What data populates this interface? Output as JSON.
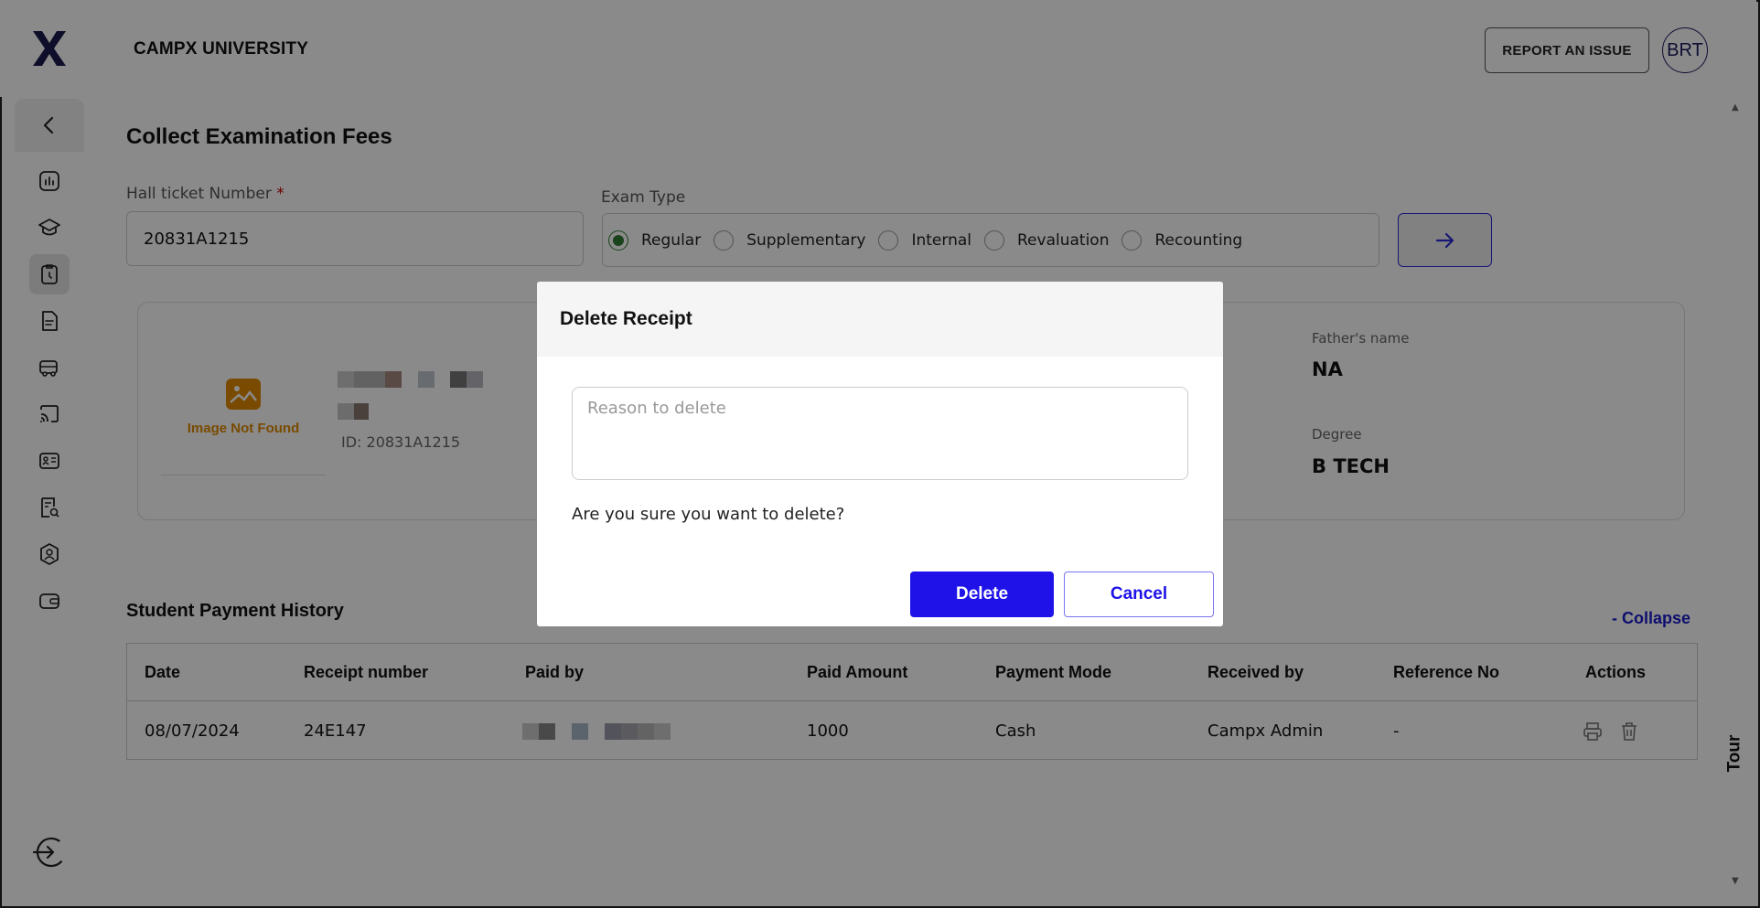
{
  "header": {
    "brand": "CAMPX UNIVERSITY",
    "report_label": "REPORT AN ISSUE",
    "avatar_initials": "BRT"
  },
  "sidebar": {
    "items": [
      {
        "icon": "analytics-icon"
      },
      {
        "icon": "graduation-cap-icon"
      },
      {
        "icon": "exam-clipboard-icon",
        "active": true
      },
      {
        "icon": "document-icon"
      },
      {
        "icon": "bus-icon"
      },
      {
        "icon": "cast-icon"
      },
      {
        "icon": "id-card-icon"
      },
      {
        "icon": "receipt-search-icon"
      },
      {
        "icon": "user-badge-icon"
      },
      {
        "icon": "wallet-icon"
      }
    ]
  },
  "page": {
    "title": "Collect Examination Fees",
    "hall_ticket_label": "Hall ticket Number",
    "hall_ticket_required": "*",
    "hall_ticket_value": "20831A1215",
    "exam_type_label": "Exam Type",
    "exam_types": [
      "Regular",
      "Supplementary",
      "Internal",
      "Revaluation",
      "Recounting"
    ],
    "exam_type_selected": "Regular"
  },
  "student": {
    "image_placeholder": "Image Not Found",
    "id_text": "ID: 20831A1215",
    "fathers_name_label": "Father's name",
    "fathers_name_value": "NA",
    "degree_label": "Degree",
    "degree_value": "B TECH"
  },
  "history": {
    "title": "Student Payment History",
    "collapse_label": "- Collapse",
    "columns": [
      "Date",
      "Receipt number",
      "Paid by",
      "Paid Amount",
      "Payment Mode",
      "Received by",
      "Reference No",
      "Actions"
    ],
    "rows": [
      {
        "date": "08/07/2024",
        "receipt": "24E147",
        "paid_amount": "1000",
        "mode": "Cash",
        "received_by": "Campx Admin",
        "reference": "-"
      }
    ]
  },
  "tour_label": "Tour",
  "modal": {
    "title": "Delete Receipt",
    "reason_placeholder": "Reason to delete",
    "confirm_text": "Are you sure you want to delete?",
    "delete_label": "Delete",
    "cancel_label": "Cancel"
  },
  "colors": {
    "primary": "#1e12e8",
    "selected_radio": "#2e7d32",
    "placeholder_accent": "#e08a00"
  }
}
